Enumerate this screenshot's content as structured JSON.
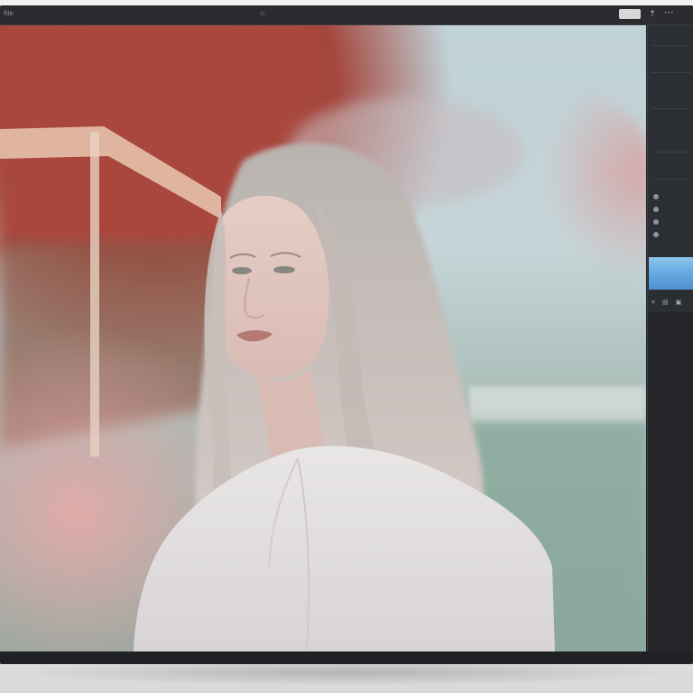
{
  "topbar": {
    "left_label": "file",
    "badge_label": "",
    "icon": "share-icon",
    "menu_label": ""
  },
  "canvas": {
    "description_free": true
  },
  "panel": {
    "rows": [
      {
        "label": "",
        "value": ""
      },
      {
        "label": "",
        "value": ""
      },
      {
        "label": "",
        "value": ""
      },
      {
        "label": "",
        "value": ""
      },
      {
        "label": "",
        "value": ""
      },
      {
        "label": "",
        "value": ""
      },
      {
        "label": "",
        "value": ""
      },
      {
        "label": "",
        "value": ""
      },
      {
        "label": "",
        "value": ""
      },
      {
        "label": "",
        "value": ""
      },
      {
        "label": "",
        "value": ""
      },
      {
        "label": "",
        "value": ""
      }
    ],
    "icons": [
      "crop-icon",
      "layers-icon",
      "export-icon"
    ]
  },
  "colors": {
    "frame": "#1d1f22",
    "panel": "#2b2e33",
    "accent_swatch": "#6aaee4"
  }
}
